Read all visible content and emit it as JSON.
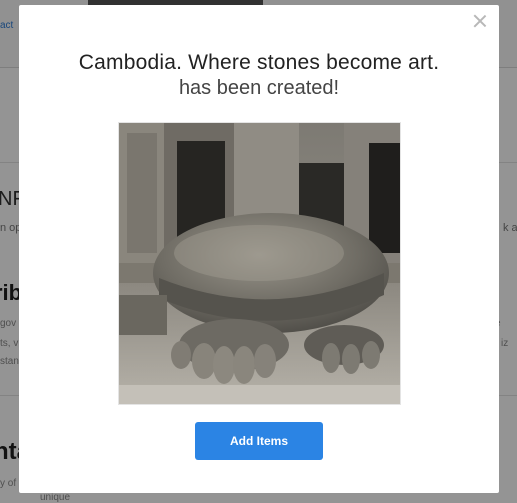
{
  "background": {
    "link_text": "act",
    "heading_1": "NFT",
    "small_1": "n op",
    "heading_2": "rib",
    "small_2": "gov",
    "small_3": "ts, v",
    "small_4": "stan",
    "heading_3": "nta",
    "small_5": "y of",
    "right_1": "k a",
    "right_2": "e",
    "right_3": "iz",
    "bottom_text": "unique"
  },
  "modal": {
    "title": "Cambodia. Where stones become art.",
    "subtitle": "has been created!",
    "image_icon": "stone-turtle-sculpture-photo",
    "close_icon": "close-icon",
    "add_button_label": "Add Items",
    "colors": {
      "accent": "#2b84e4",
      "overlay": "rgba(0,0,0,0.42)"
    }
  }
}
